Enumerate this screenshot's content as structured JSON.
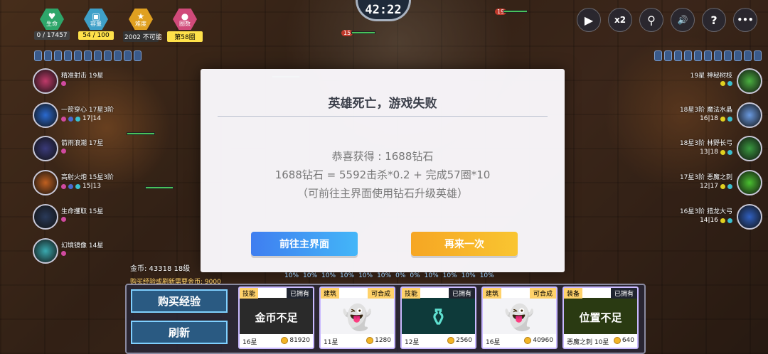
{
  "timer": "42:22",
  "stats": [
    {
      "icon": "heart-icon",
      "label": "生命",
      "value": "0 / 17457",
      "color": "#2ea66a",
      "valbg": "#404040"
    },
    {
      "icon": "cup-icon",
      "label": "容量",
      "value": "54 / 100",
      "color": "#3fa0c8",
      "valbg": "#ffe14a"
    },
    {
      "icon": "star-icon",
      "label": "难度",
      "value": "2002 不可能",
      "color": "#e0a020",
      "valbg": "#333"
    },
    {
      "icon": "circle-icon",
      "label": "圈数",
      "value": "第58圈",
      "color": "#d04a7a",
      "valbg": "#ffe14a"
    }
  ],
  "top_buttons": [
    {
      "name": "play-button",
      "glyph": "▶"
    },
    {
      "name": "speed-button",
      "glyph": "x2"
    },
    {
      "name": "search-button",
      "glyph": "⚲"
    },
    {
      "name": "sound-button",
      "glyph": "🔊"
    },
    {
      "name": "help-button",
      "glyph": "?"
    },
    {
      "name": "more-button",
      "glyph": "•••"
    }
  ],
  "left_skills": [
    {
      "name": "精准射击 19星",
      "sub": "",
      "color": "#c03a6a"
    },
    {
      "name": "一箭穿心 17星3阶",
      "sub": "17|14",
      "color": "#2a6ad0"
    },
    {
      "name": "箭雨浪潮 17星",
      "sub": "",
      "color": "#3a3a7a"
    },
    {
      "name": "高射火炮 15星3阶",
      "sub": "15|13",
      "color": "#c06020"
    },
    {
      "name": "生命攫取 15星",
      "sub": "",
      "color": "#2a3a5a"
    },
    {
      "name": "幻境镜像 14星",
      "sub": "",
      "color": "#3aaab0"
    }
  ],
  "right_skills": [
    {
      "name": "19星 神秘树枝",
      "sub": "",
      "color": "#4ab040"
    },
    {
      "name": "18星3阶 魔法水晶",
      "sub": "16|18",
      "color": "#6a9ae0"
    },
    {
      "name": "18星3阶 林野长弓",
      "sub": "13|18",
      "color": "#3a9a40"
    },
    {
      "name": "17星3阶 恶魔之刺",
      "sub": "12|17",
      "color": "#4ac030"
    },
    {
      "name": "16星3阶 猎龙大弓",
      "sub": "14|16",
      "color": "#3060c0"
    }
  ],
  "modal": {
    "title": "英雄死亡，游戏失败",
    "reward": "恭喜获得 : 1688钻石",
    "formula": "1688钻石 = 5592击杀*0.2 + 完成57圈*10",
    "tip": "（可前往主界面使用钻石升级英雄）",
    "btn_home": "前往主界面",
    "btn_retry": "再来一次"
  },
  "shop": {
    "gold_label": "金币: 43318   18级",
    "hint": "购买经验或刷新需要金币: 9000",
    "percents": [
      "10%",
      "10%",
      "10%",
      "10%",
      "10%",
      "10%",
      "0%",
      "0%",
      "10%",
      "10%",
      "10%",
      "10%"
    ],
    "buy_exp": "购买经验",
    "refresh": "刷新",
    "cards": [
      {
        "type": "技能",
        "status": "已拥有",
        "center": "金币不足",
        "level": "16星",
        "price": "81920",
        "bg": "#2a2a2a"
      },
      {
        "type": "建筑",
        "status": "可合成",
        "center": "",
        "level": "11星",
        "price": "1280",
        "bg": "#f3f3f6"
      },
      {
        "type": "技能",
        "status": "已拥有",
        "center": "",
        "level": "12星",
        "price": "2560",
        "bg": "#0e3a3a"
      },
      {
        "type": "建筑",
        "status": "可合成",
        "center": "",
        "level": "16星",
        "price": "40960",
        "bg": "#f3f3f6"
      },
      {
        "type": "装备",
        "status": "已拥有",
        "center": "位置不足",
        "level": "恶魔之刺 10星",
        "price": "640",
        "bg": "#2a3a12"
      }
    ]
  }
}
